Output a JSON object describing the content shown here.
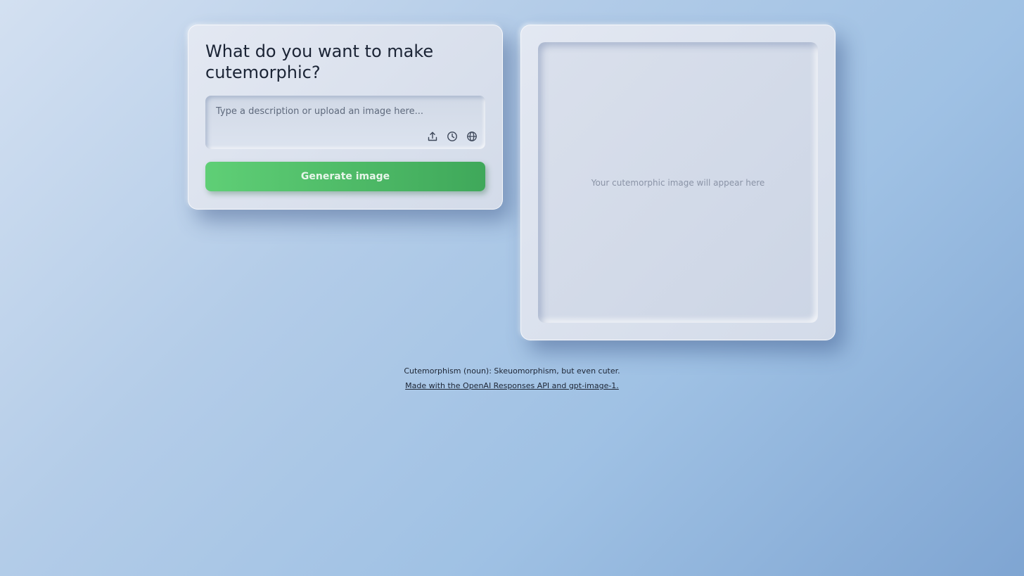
{
  "generator": {
    "title": "What do you want to make cutemorphic?",
    "prompt_placeholder": "Type a description or upload an image here...",
    "prompt_value": "",
    "tools": [
      {
        "icon": "upload-icon"
      },
      {
        "icon": "clock-icon"
      },
      {
        "icon": "globe-icon"
      }
    ],
    "generate_label": "Generate image",
    "accent_color": "#4cbb67"
  },
  "preview": {
    "placeholder": "Your cutemorphic image will appear here"
  },
  "footer": {
    "definition": "Cutemorphism (noun): Skeuomorphism, but even cuter.",
    "credit_link": "Made with the OpenAI Responses API and gpt-image-1."
  }
}
